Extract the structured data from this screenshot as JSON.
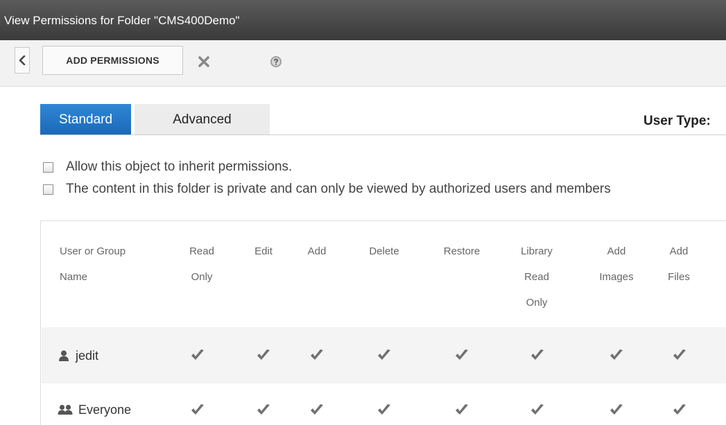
{
  "window": {
    "title": "View Permissions for Folder \"CMS400Demo\""
  },
  "toolbar": {
    "back_icon": "chevron-left-icon",
    "add_permissions_label": "ADD PERMISSIONS",
    "close_icon": "close-icon",
    "help_icon": "help-icon"
  },
  "tabs": [
    {
      "label": "Standard",
      "active": true
    },
    {
      "label": "Advanced",
      "active": false
    }
  ],
  "user_type_label": "User Type:",
  "options": {
    "inherit_label": "Allow this object to inherit permissions.",
    "private_label": "The content in this folder is private and can only be viewed by authorized users and members",
    "inherit_checked": false,
    "private_checked": false
  },
  "table": {
    "columns": [
      [
        "User or Group",
        "Name"
      ],
      [
        "Read",
        "Only"
      ],
      [
        "Edit"
      ],
      [
        "Add"
      ],
      [
        "Delete"
      ],
      [
        "Restore"
      ],
      [
        "Library",
        "Read",
        "Only"
      ],
      [
        "Add",
        "Images"
      ],
      [
        "Add",
        "Files"
      ]
    ],
    "rows": [
      {
        "name": "jedit",
        "icon": "user-icon",
        "permissions": [
          true,
          true,
          true,
          true,
          true,
          true,
          true,
          true
        ]
      },
      {
        "name": "Everyone",
        "icon": "group-icon",
        "permissions": [
          true,
          true,
          true,
          true,
          true,
          true,
          true,
          true
        ]
      }
    ]
  },
  "colors": {
    "titlebar": "#4a4a4a",
    "active_tab": "#2a7ccb",
    "check": "#707070"
  }
}
